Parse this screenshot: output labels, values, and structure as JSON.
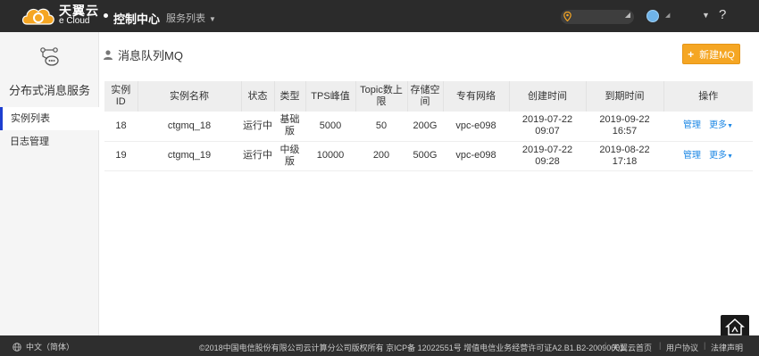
{
  "brand": {
    "name_cn": "天翼云",
    "name_en": "e Cloud"
  },
  "nav": {
    "console": "控制中心",
    "services": "服务列表"
  },
  "header": {
    "help": "?"
  },
  "sidebar": {
    "title": "分布式消息服务",
    "items": [
      {
        "label": "实例列表",
        "active": true
      },
      {
        "label": "日志管理",
        "active": false
      }
    ]
  },
  "page": {
    "title": "消息队列MQ",
    "new_button": "新建MQ"
  },
  "table": {
    "headers": [
      "实例ID",
      "实例名称",
      "状态",
      "类型",
      "TPS峰值",
      "Topic数上限",
      "存储空间",
      "专有网络",
      "创建时间",
      "到期时间",
      "操作"
    ],
    "rows": [
      {
        "id": "18",
        "name": "ctgmq_18",
        "status": "运行中",
        "type": "基础版",
        "tps": "5000",
        "topic": "50",
        "storage": "200G",
        "vpc": "vpc-e098",
        "created": "2019-07-22 09:07",
        "expires": "2019-09-22 16:57",
        "manage": "管理",
        "more": "更多"
      },
      {
        "id": "19",
        "name": "ctgmq_19",
        "status": "运行中",
        "type": "中级版",
        "tps": "10000",
        "topic": "200",
        "storage": "500G",
        "vpc": "vpc-e098",
        "created": "2019-07-22 09:28",
        "expires": "2019-08-22 17:18",
        "manage": "管理",
        "more": "更多"
      }
    ]
  },
  "footer": {
    "language": "中文（简体）",
    "copyright": "©2018中国电信股份有限公司云计算分公司版权所有 京ICP备 12022551号 增值电信业务经营许可证A2.B1.B2-20090001",
    "links": [
      "天翼云首页",
      "用户协议",
      "法律声明"
    ]
  },
  "colors": {
    "topbar": "#2b2b2b",
    "accent_orange": "#f5a623",
    "link_blue": "#1e88e5",
    "active_marker": "#1e3fd0"
  },
  "icons": [
    "ecloud-logo-icon",
    "location-pin-icon",
    "user-avatar-icon",
    "message-queue-icon",
    "user-icon",
    "plus-icon",
    "globe-icon",
    "toolbox-icon"
  ]
}
